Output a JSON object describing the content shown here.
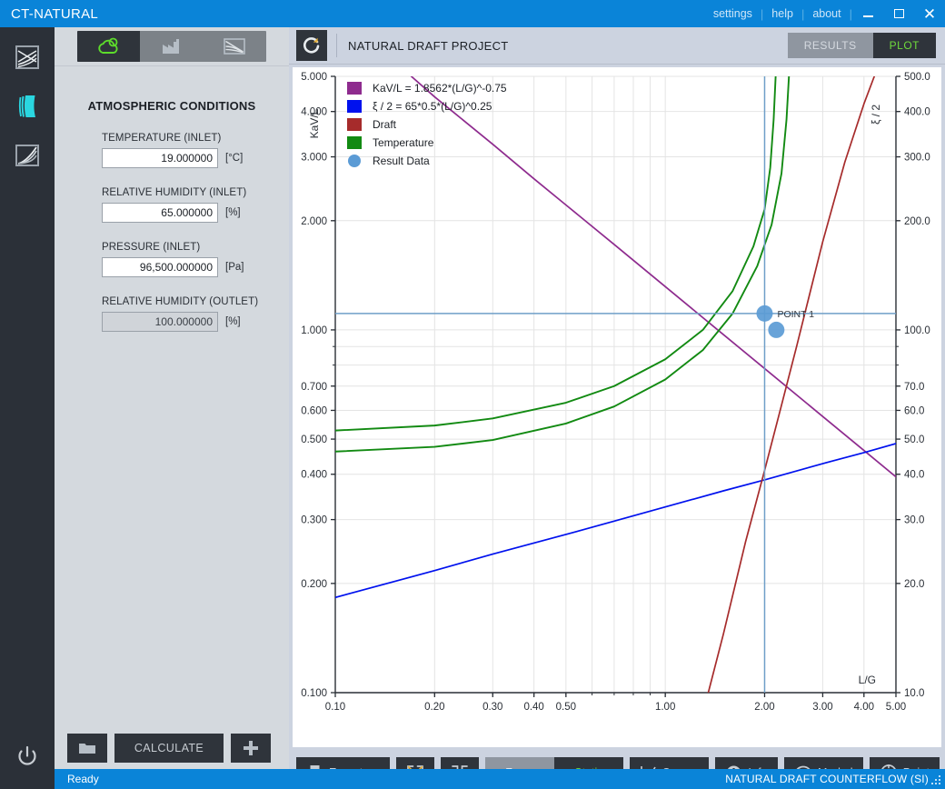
{
  "window": {
    "app_title": "CT-NATURAL",
    "menu": [
      "settings",
      "help",
      "about"
    ],
    "minimize_icon": "minimize-icon",
    "maximize_icon": "maximize-icon",
    "close_icon": "close-icon"
  },
  "rail": {
    "items": [
      {
        "name": "psychrometric-chart-icon",
        "label": "Psychrometric Chart",
        "active": false
      },
      {
        "name": "cooling-tower-icon",
        "label": "Cooling Tower",
        "active": true
      },
      {
        "name": "performance-curve-icon",
        "label": "Performance Curves",
        "active": false
      }
    ],
    "power_icon": "power-icon"
  },
  "panel": {
    "tabs": [
      {
        "name": "tab-atmospheric",
        "icon": "weather-cloud-icon",
        "active": true
      },
      {
        "name": "tab-tower",
        "icon": "factory-icon",
        "active": false
      },
      {
        "name": "tab-curves",
        "icon": "chart-curve-icon",
        "active": false
      }
    ],
    "title": "ATMOSPHERIC CONDITIONS",
    "fields": [
      {
        "label": "TEMPERATURE (INLET)",
        "value": "19.000000",
        "unit": "[°C]",
        "readonly": false
      },
      {
        "label": "RELATIVE HUMIDITY (INLET)",
        "value": "65.000000",
        "unit": "[%]",
        "readonly": false
      },
      {
        "label": "PRESSURE (INLET)",
        "value": "96,500.000000",
        "unit": "[Pa]",
        "readonly": false
      },
      {
        "label": "RELATIVE HUMIDITY (OUTLET)",
        "value": "100.000000",
        "unit": "[%]",
        "readonly": true
      }
    ]
  },
  "left_actions": {
    "open_icon": "folder-icon",
    "calculate_label": "CALCULATE",
    "add_icon": "plus-icon"
  },
  "plot_header": {
    "refresh_icon": "refresh-icon",
    "project_title": "NATURAL DRAFT PROJECT",
    "view_tabs": [
      {
        "label": "RESULTS",
        "active": false
      },
      {
        "label": "PLOT",
        "active": true
      }
    ]
  },
  "toolbar": {
    "export_label": "Export",
    "export_icon": "printer-icon",
    "expand_icon": "expand-icon",
    "collapse_icon": "collapse-icon",
    "zoom_label": "Zoom",
    "static_label": "Static",
    "static_active": true,
    "buttons": [
      {
        "label": "Curves",
        "icon": "curves-icon"
      },
      {
        "label": "Info",
        "icon": "info-icon"
      },
      {
        "label": "Merkel",
        "icon": "merkel-icon"
      },
      {
        "label": "Point",
        "icon": "target-icon"
      }
    ]
  },
  "statusbar": {
    "left": "Ready",
    "right": "NATURAL DRAFT COUNTERFLOW (SI)",
    "grip_icon": "resize-grip-icon"
  },
  "chart_data": {
    "type": "line",
    "title": "",
    "xlabel": "L/G",
    "ylabel": "KaV/L",
    "y2label": "ξ / 2",
    "xscale": "log",
    "yscale": "log",
    "xlim": [
      0.1,
      5.0
    ],
    "ylim": [
      0.1,
      5.0
    ],
    "y2lim": [
      10.0,
      500.0
    ],
    "grid": true,
    "legend_position": "top-left",
    "xticks": [
      0.1,
      0.2,
      0.3,
      0.4,
      0.5,
      1.0,
      2.0,
      3.0,
      4.0,
      5.0
    ],
    "xticklabels": [
      "0.10",
      "0.20",
      "0.30",
      "0.40",
      "0.50",
      "1.00",
      "2.00",
      "3.00",
      "4.00",
      "5.00"
    ],
    "yticks": [
      0.1,
      0.2,
      0.3,
      0.4,
      0.5,
      0.6,
      0.7,
      1.0,
      2.0,
      3.0,
      4.0,
      5.0
    ],
    "yticklabels": [
      "0.100",
      "0.200",
      "0.300",
      "0.400",
      "0.500",
      "0.600",
      "0.700",
      "1.000",
      "2.000",
      "3.000",
      "4.000",
      "5.000"
    ],
    "y2ticks": [
      10.0,
      20.0,
      30.0,
      40.0,
      50.0,
      60.0,
      70.0,
      100.0,
      200.0,
      300.0,
      400.0,
      500.0
    ],
    "y2ticklabels": [
      "10.0",
      "20.0",
      "30.0",
      "40.0",
      "50.0",
      "60.0",
      "70.0",
      "100.0",
      "200.0",
      "300.0",
      "400.0",
      "500.0"
    ],
    "series": [
      {
        "name": "KaV/L = 1.8562*(L/G)^-0.75",
        "color": "#8e2b8e",
        "type": "line",
        "equation": "KaV/L = 1.8562*(L/G)^-0.75",
        "points": [
          [
            0.17,
            5.0
          ],
          [
            0.2,
            4.39
          ],
          [
            0.3,
            3.25
          ],
          [
            0.4,
            2.61
          ],
          [
            0.5,
            2.21
          ],
          [
            0.7,
            1.72
          ],
          [
            1.0,
            1.3162
          ],
          [
            1.5,
            0.9708
          ],
          [
            2.0,
            0.7825
          ],
          [
            3.0,
            0.5772
          ],
          [
            4.0,
            0.4652
          ],
          [
            5.0,
            0.3935
          ]
        ]
      },
      {
        "name": "ξ / 2 = 65*0.5*(L/G)^0.25",
        "color": "#0011ee",
        "type": "line",
        "equation": "ξ / 2 = 65*0.5*(L/G)^0.25",
        "points": [
          [
            0.1,
            18.3
          ],
          [
            0.2,
            21.7
          ],
          [
            0.3,
            24.1
          ],
          [
            0.5,
            27.3
          ],
          [
            0.7,
            29.7
          ],
          [
            1.0,
            32.5
          ],
          [
            1.5,
            36.0
          ],
          [
            2.0,
            38.6
          ],
          [
            3.0,
            42.8
          ],
          [
            4.0,
            45.9
          ],
          [
            5.0,
            48.6
          ]
        ]
      },
      {
        "name": "Draft",
        "color": "#a62b2b",
        "type": "line",
        "points": [
          [
            1.35,
            10.0
          ],
          [
            1.5,
            14.5
          ],
          [
            1.75,
            26.0
          ],
          [
            2.0,
            41.0
          ],
          [
            2.25,
            62.0
          ],
          [
            2.5,
            90.0
          ],
          [
            3.0,
            175.0
          ],
          [
            3.5,
            290.0
          ],
          [
            4.0,
            420.0
          ],
          [
            4.3,
            500.0
          ]
        ]
      },
      {
        "name": "Temperature",
        "color": "#128a12",
        "type": "line",
        "curves": [
          {
            "id": "temperature-curve-1",
            "points": [
              [
                0.1,
                0.528
              ],
              [
                0.2,
                0.545
              ],
              [
                0.3,
                0.57
              ],
              [
                0.5,
                0.63
              ],
              [
                0.7,
                0.7
              ],
              [
                1.0,
                0.83
              ],
              [
                1.3,
                1.0
              ],
              [
                1.6,
                1.28
              ],
              [
                1.85,
                1.7
              ],
              [
                2.0,
                2.15
              ],
              [
                2.08,
                2.8
              ],
              [
                2.13,
                3.8
              ],
              [
                2.16,
                5.0
              ]
            ]
          },
          {
            "id": "temperature-curve-2",
            "points": [
              [
                0.1,
                0.462
              ],
              [
                0.2,
                0.476
              ],
              [
                0.3,
                0.497
              ],
              [
                0.5,
                0.552
              ],
              [
                0.7,
                0.615
              ],
              [
                1.0,
                0.73
              ],
              [
                1.3,
                0.88
              ],
              [
                1.6,
                1.11
              ],
              [
                1.9,
                1.5
              ],
              [
                2.1,
                1.95
              ],
              [
                2.25,
                2.7
              ],
              [
                2.33,
                3.8
              ],
              [
                2.37,
                5.0
              ]
            ]
          }
        ]
      }
    ],
    "result_points": [
      {
        "name": "POINT 1",
        "x": 2.0,
        "y": 1.11,
        "label": "POINT 1",
        "color": "#5b9bd5"
      },
      {
        "name": "result-point-2",
        "x": 2.17,
        "y": 1.0,
        "color": "#5b9bd5"
      }
    ],
    "crosshair": {
      "x": 2.0,
      "y": 1.11,
      "color": "#6f9fc8"
    },
    "legend": [
      {
        "label": "KaV/L = 1.8562*(L/G)^-0.75",
        "color": "#8e2b8e",
        "marker": "square"
      },
      {
        "label": "ξ / 2 = 65*0.5*(L/G)^0.25",
        "color": "#0011ee",
        "marker": "square"
      },
      {
        "label": "Draft",
        "color": "#a62b2b",
        "marker": "square"
      },
      {
        "label": "Temperature",
        "color": "#128a12",
        "marker": "square"
      },
      {
        "label": "Result Data",
        "color": "#5b9bd5",
        "marker": "circle"
      }
    ]
  }
}
